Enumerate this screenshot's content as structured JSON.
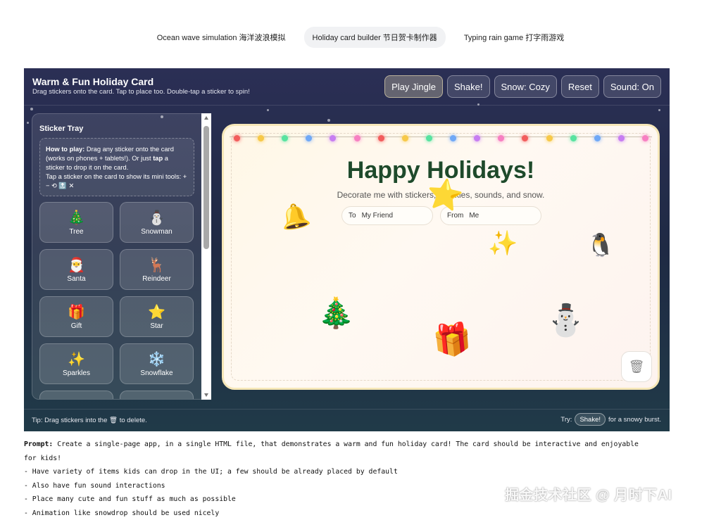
{
  "tabs": [
    {
      "label": "Ocean wave simulation  海洋波浪模拟",
      "active": false
    },
    {
      "label": "Holiday card builder  节日贺卡制作器",
      "active": true
    },
    {
      "label": "Typing rain game  打字雨游戏",
      "active": false
    }
  ],
  "header": {
    "title": "Warm & Fun Holiday Card",
    "subtitle": "Drag stickers onto the card. Tap to place too. Double-tap a sticker to spin!",
    "buttons": {
      "play_jingle": "Play Jingle",
      "shake": "Shake!",
      "snow": "Snow: Cozy",
      "reset": "Reset",
      "sound": "Sound: On"
    }
  },
  "tray": {
    "title": "Sticker Tray",
    "howto": {
      "lead": "How to play:",
      "text1": " Drag any sticker onto the card (works on phones + tablets!). Or just ",
      "tap": "tap",
      "text2": " a sticker to drop it on the card.",
      "line2": "Tap a sticker on the card to show its mini tools: + − ⟲ 🔝 ✕"
    },
    "stickers": [
      {
        "emoji": "🎄",
        "label": "Tree"
      },
      {
        "emoji": "⛄",
        "label": "Snowman"
      },
      {
        "emoji": "🎅",
        "label": "Santa"
      },
      {
        "emoji": "🦌",
        "label": "Reindeer"
      },
      {
        "emoji": "🎁",
        "label": "Gift"
      },
      {
        "emoji": "⭐",
        "label": "Star"
      },
      {
        "emoji": "✨",
        "label": "Sparkles"
      },
      {
        "emoji": "❄️",
        "label": "Snowflake"
      },
      {
        "emoji": "🔔",
        "label": ""
      },
      {
        "emoji": "🧣",
        "label": ""
      }
    ]
  },
  "card": {
    "title": "Happy Holidays!",
    "subtitle": "Decorate me with stickers, sparkles, sounds, and snow.",
    "to_label": "To",
    "to_value": "My Friend",
    "from_label": "From",
    "from_value": "Me",
    "trash_icon": "🗑",
    "light_colors": [
      "#f25c5c",
      "#f7c948",
      "#57e3a0",
      "#6fa8f7",
      "#c77df2",
      "#f77fc2"
    ],
    "placed": [
      {
        "emoji": "🔔",
        "name": "placed-bell"
      },
      {
        "emoji": "⭐",
        "name": "placed-star"
      },
      {
        "emoji": "✨",
        "name": "placed-sparkles"
      },
      {
        "emoji": "🐧",
        "name": "placed-penguin"
      },
      {
        "emoji": "🎄",
        "name": "placed-tree"
      },
      {
        "emoji": "🎁",
        "name": "placed-gift"
      },
      {
        "emoji": "⛄",
        "name": "placed-snowman"
      }
    ]
  },
  "footer": {
    "tip_pre": "Tip: Drag stickers into the ",
    "tip_icon": "🗑",
    "tip_post": " to delete.",
    "try_label": "Try:",
    "try_button": "Shake!",
    "try_post": "for a snowy burst."
  },
  "prompt": {
    "label": "Prompt:",
    "line1": " Create a single-page app, in a single HTML file, that demonstrates a warm and fun holiday card! The card should be interactive and enjoyable",
    "line1b": "for kids!",
    "lines": [
      "- Have variety of items kids can drop in the UI; a few should be already placed by default",
      "- Also have fun sound interactions",
      "- Place many cute and fun stuff as much as possible",
      "- Animation like snowdrop should be used nicely"
    ]
  },
  "watermark": "掘金技术社区 @ 月时下AI"
}
